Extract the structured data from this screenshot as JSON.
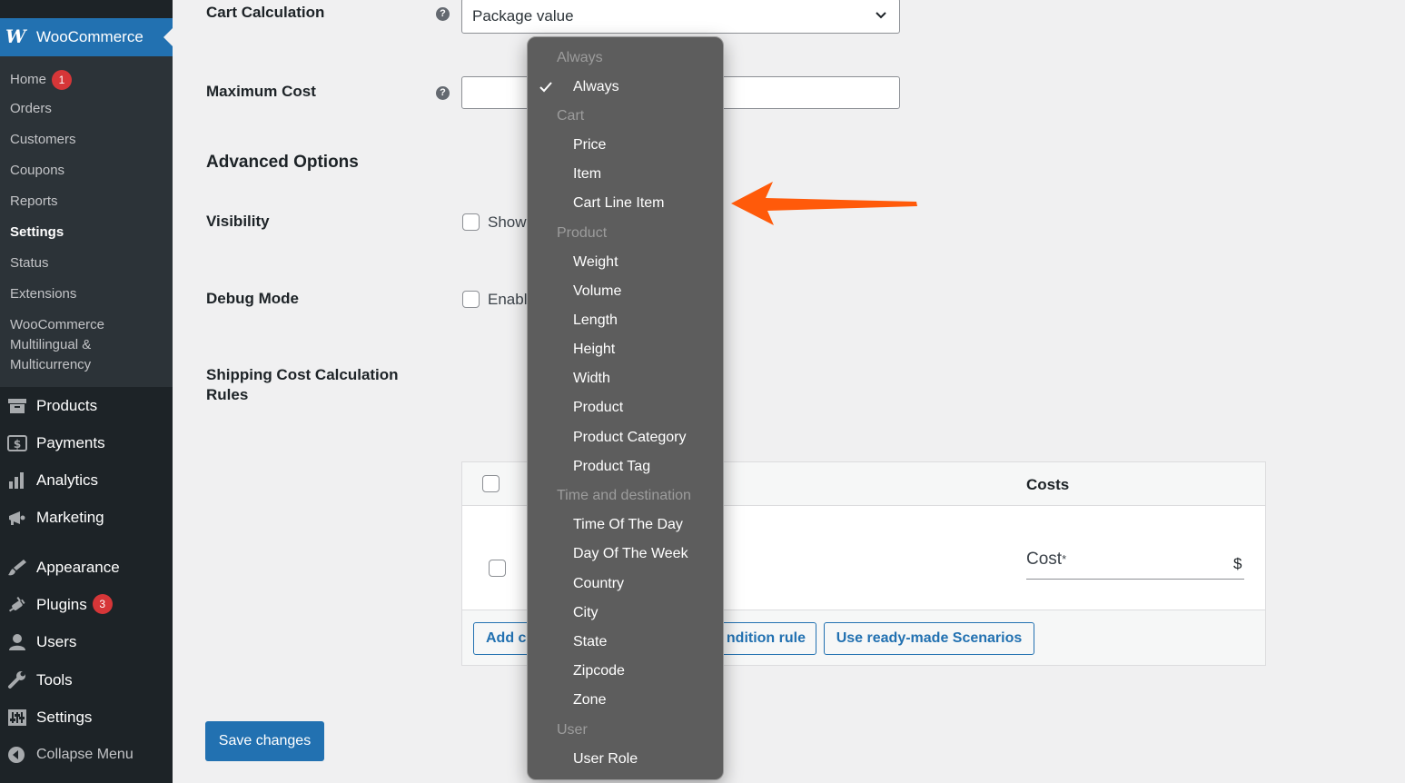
{
  "sidebar": {
    "brand": {
      "logo": "W",
      "title": "WooCommerce"
    },
    "submenu": [
      {
        "label": "Home",
        "badge": "1"
      },
      {
        "label": "Orders"
      },
      {
        "label": "Customers"
      },
      {
        "label": "Coupons"
      },
      {
        "label": "Reports"
      },
      {
        "label": "Settings",
        "current": true
      },
      {
        "label": "Status"
      },
      {
        "label": "Extensions"
      },
      {
        "label": "WooCommerce Multilingual & Multicurrency"
      }
    ],
    "menu": [
      {
        "label": "Products",
        "icon": "archive-icon"
      },
      {
        "label": "Payments",
        "icon": "dollar-icon"
      },
      {
        "label": "Analytics",
        "icon": "bar-chart-icon"
      },
      {
        "label": "Marketing",
        "icon": "megaphone-icon"
      },
      {
        "label": "Appearance",
        "icon": "paintbrush-icon"
      },
      {
        "label": "Plugins",
        "icon": "plug-icon",
        "badge": "3"
      },
      {
        "label": "Users",
        "icon": "user-icon"
      },
      {
        "label": "Tools",
        "icon": "wrench-icon"
      },
      {
        "label": "Settings",
        "icon": "sliders-icon"
      },
      {
        "label": "Collapse Menu",
        "icon": "collapse-icon"
      }
    ]
  },
  "form": {
    "cart_calculation": {
      "label": "Cart Calculation",
      "value": "Package value"
    },
    "maximum_cost": {
      "label": "Maximum Cost",
      "value": ""
    },
    "advanced_options": "Advanced Options",
    "visibility": {
      "label": "Visibility",
      "checkbox_text": "Show"
    },
    "debug_mode": {
      "label": "Debug Mode",
      "checkbox_text": "Enabl"
    },
    "rules": {
      "label": "Shipping Cost Calculation Rules",
      "costs_header": "Costs",
      "cost_field_label": "Cost",
      "cost_required_mark": "*",
      "currency": "$",
      "add_button": "Add c",
      "condition_button": "ndition rule",
      "scenarios_button": "Use ready-made Scenarios"
    },
    "save_button": "Save changes"
  },
  "dropdown": {
    "groups": [
      {
        "label": "Always",
        "options": [
          {
            "label": "Always",
            "selected": true
          }
        ]
      },
      {
        "label": "Cart",
        "options": [
          {
            "label": "Price"
          },
          {
            "label": "Item"
          },
          {
            "label": "Cart Line Item"
          }
        ]
      },
      {
        "label": "Product",
        "options": [
          {
            "label": "Weight"
          },
          {
            "label": "Volume"
          },
          {
            "label": "Length"
          },
          {
            "label": "Height"
          },
          {
            "label": "Width"
          },
          {
            "label": "Product"
          },
          {
            "label": "Product Category"
          },
          {
            "label": "Product Tag"
          }
        ]
      },
      {
        "label": "Time and destination",
        "options": [
          {
            "label": "Time Of The Day"
          },
          {
            "label": "Day Of The Week"
          },
          {
            "label": "Country"
          },
          {
            "label": "City"
          },
          {
            "label": "State"
          },
          {
            "label": "Zipcode"
          },
          {
            "label": "Zone"
          }
        ]
      },
      {
        "label": "User",
        "options": [
          {
            "label": "User Role"
          }
        ]
      }
    ]
  },
  "colors": {
    "sidebar_bg": "#1d2327",
    "submenu_bg": "#2c3338",
    "accent": "#2271b1",
    "badge": "#d63638",
    "dropdown_bg": "#5d5d5d",
    "annotation_arrow": "#ff5a0a"
  }
}
